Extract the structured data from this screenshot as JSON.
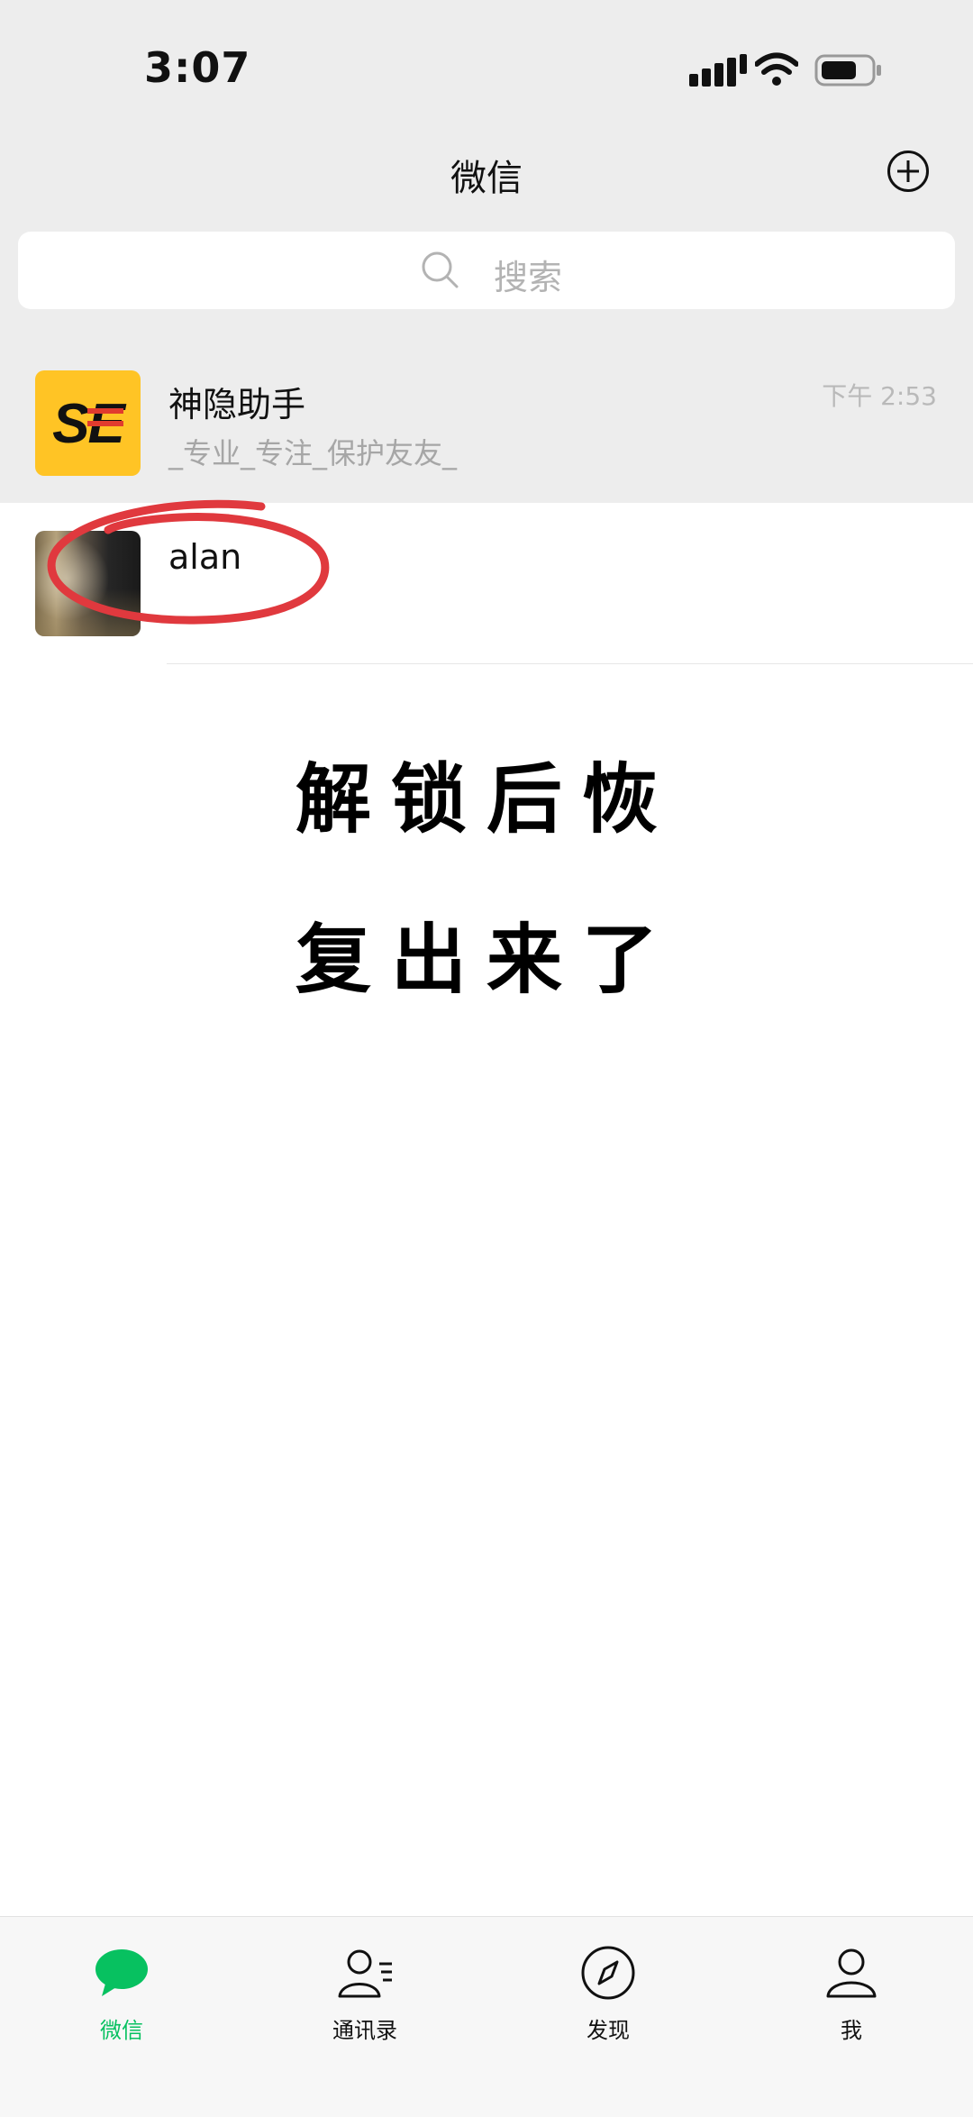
{
  "status_bar": {
    "time": "3:07"
  },
  "header": {
    "title": "微信"
  },
  "search": {
    "placeholder": "搜索"
  },
  "chats": [
    {
      "name": "神隐助手",
      "last_message": "_专业_专注_保护友友_",
      "time": "下午 2:53",
      "avatar_text": "SE"
    },
    {
      "name": "alan"
    }
  ],
  "overlay_text": {
    "line1": "解锁后恢",
    "line2": "复出来了"
  },
  "tabs": [
    {
      "label": "微信",
      "active": true
    },
    {
      "label": "通讯录"
    },
    {
      "label": "发现"
    },
    {
      "label": "我"
    }
  ],
  "colors": {
    "accent": "#07c160",
    "annotation": "#e0393e",
    "avatar_yellow": "#ffc425"
  }
}
